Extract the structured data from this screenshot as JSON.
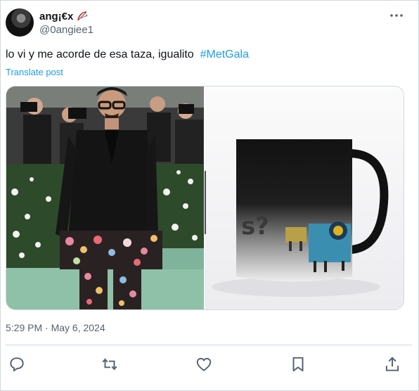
{
  "author": {
    "display_name": "ang¡€x",
    "handle": "@0angiee1",
    "badge_icon": "bow-and-arrow-icon",
    "avatar_icon": "avatar-photo"
  },
  "tweet": {
    "text": "lo vi y me acorde de esa taza, igualito",
    "hashtag": "#MetGala",
    "translate_label": "Translate post",
    "timestamp": "5:29 PM · May 6, 2024"
  },
  "media": {
    "left_image": "man-in-black-suit-floral-pants-photo",
    "right_image": "color-changing-mug-photo"
  },
  "actions": {
    "reply_icon": "reply-icon",
    "retweet_icon": "retweet-icon",
    "like_icon": "heart-icon",
    "bookmark_icon": "bookmark-icon",
    "share_icon": "share-icon",
    "more_icon": "more-icon"
  },
  "colors": {
    "accent": "#1d9bf0",
    "muted": "#536471",
    "text": "#0f1419",
    "border": "#cfd9de"
  }
}
